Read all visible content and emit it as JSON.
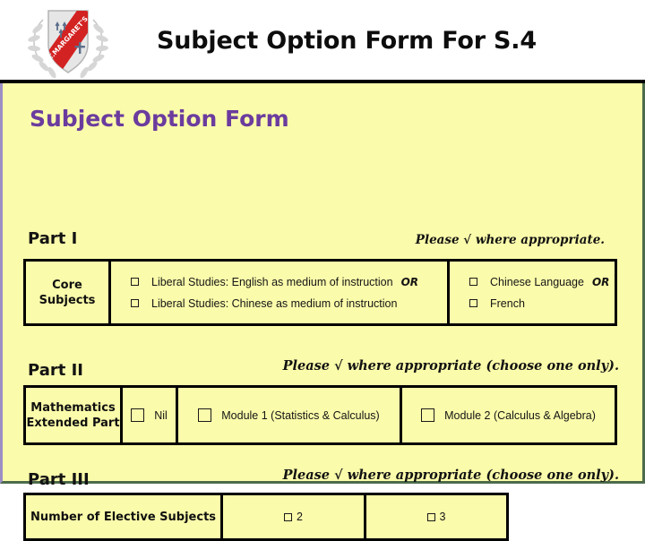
{
  "header": {
    "title": "Subject Option Form For S.4",
    "crest": {
      "name": "st-margarets-school-crest",
      "band_text": "ST.MARGARET'S",
      "band_color": "#d32222",
      "shield_color": "#e3e3e3"
    }
  },
  "form": {
    "title": "Subject Option Form",
    "accent_color": "#6b3c9e",
    "background_color": "#fbfcab"
  },
  "part1": {
    "label": "Part I",
    "hint": "Please √ where appropriate.",
    "row_header": "Core\nSubjects",
    "row_header_line1": "Core",
    "row_header_line2": "Subjects",
    "options_col1": [
      {
        "checkbox": "unchecked",
        "label": "Liberal Studies: English as medium of instruction",
        "suffix": "OR"
      },
      {
        "checkbox": "unchecked",
        "label": "Liberal Studies: Chinese as medium of instruction",
        "suffix": ""
      }
    ],
    "options_col2": [
      {
        "checkbox": "unchecked",
        "label": "Chinese Language",
        "suffix": "OR"
      },
      {
        "checkbox": "unchecked",
        "label": "French",
        "suffix": ""
      }
    ]
  },
  "part2": {
    "label": "Part II",
    "hint": "Please √ where appropriate (choose one only).",
    "row_header_line1": "Mathematics",
    "row_header_line2": "Extended Part",
    "options": [
      {
        "checkbox": "unchecked",
        "label": "Nil"
      },
      {
        "checkbox": "unchecked",
        "label": "Module 1 (Statistics & Calculus)"
      },
      {
        "checkbox": "unchecked",
        "label": "Module 2 (Calculus &  Algebra)"
      }
    ]
  },
  "part3": {
    "label": "Part III",
    "hint": "Please √ where appropriate (choose one only).",
    "row_header": "Number of Elective Subjects",
    "options": [
      {
        "checkbox": "unchecked",
        "label": "2"
      },
      {
        "checkbox": "unchecked",
        "label": "3"
      }
    ]
  }
}
